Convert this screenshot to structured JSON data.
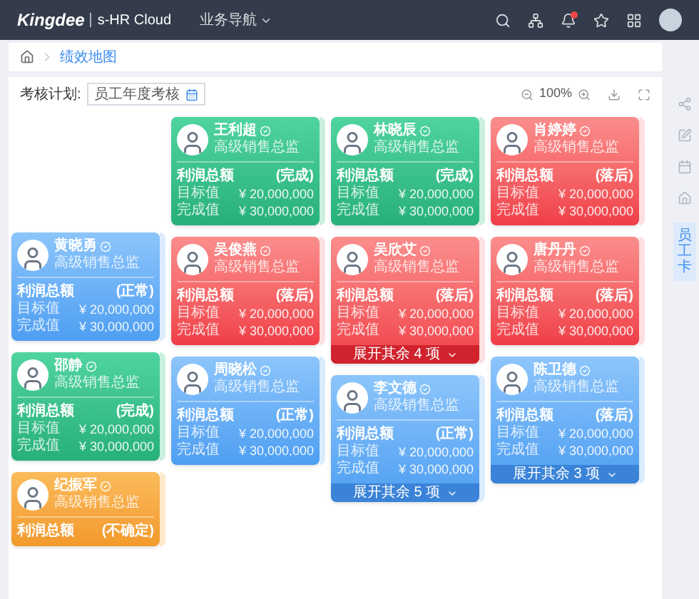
{
  "header": {
    "logo": "Kingdee",
    "product": "s-HR Cloud",
    "nav": "业务导航"
  },
  "breadcrumb": {
    "current": "绩效地图"
  },
  "toolbar": {
    "label": "考核计划:",
    "plan": "员工年度考核",
    "zoom": "100%"
  },
  "side_tab": "员工卡",
  "columns": [
    {
      "cards": [
        {
          "name": "黄晓勇",
          "title": "高级销售总监",
          "metric": "利润总额",
          "status": "(正常)",
          "kind": "normal",
          "rows": [
            {
              "label": "目标值",
              "value": "¥ 20,000,000"
            },
            {
              "label": "完成值",
              "value": "¥ 30,000,000"
            }
          ]
        },
        {
          "name": "邵静",
          "title": "高级销售总监",
          "metric": "利润总额",
          "status": "(完成)",
          "kind": "done",
          "rows": [
            {
              "label": "目标值",
              "value": "¥ 20,000,000"
            },
            {
              "label": "完成值",
              "value": "¥ 30,000,000"
            }
          ]
        },
        {
          "name": "纪振军",
          "title": "高级销售总监",
          "metric": "利润总额",
          "status": "(不确定)",
          "kind": "uncertain"
        }
      ]
    },
    {
      "cards": [
        {
          "name": "王利超",
          "title": "高级销售总监",
          "metric": "利润总额",
          "status": "(完成)",
          "kind": "done",
          "rows": [
            {
              "label": "目标值",
              "value": "¥ 20,000,000"
            },
            {
              "label": "完成值",
              "value": "¥ 30,000,000"
            }
          ]
        },
        {
          "name": "吴俊燕",
          "title": "高级销售总监",
          "metric": "利润总额",
          "status": "(落后)",
          "kind": "behind",
          "rows": [
            {
              "label": "目标值",
              "value": "¥ 20,000,000"
            },
            {
              "label": "完成值",
              "value": "¥ 30,000,000"
            }
          ]
        },
        {
          "name": "周晓松",
          "title": "高级销售总监",
          "metric": "利润总额",
          "status": "(正常)",
          "kind": "normal",
          "rows": [
            {
              "label": "目标值",
              "value": "¥ 20,000,000"
            },
            {
              "label": "完成值",
              "value": "¥ 30,000,000"
            }
          ]
        }
      ]
    },
    {
      "cards": [
        {
          "name": "林晓辰",
          "title": "高级销售总监",
          "metric": "利润总额",
          "status": "(完成)",
          "kind": "done",
          "rows": [
            {
              "label": "目标值",
              "value": "¥ 20,000,000"
            },
            {
              "label": "完成值",
              "value": "¥ 30,000,000"
            }
          ]
        },
        {
          "name": "吴欣艾",
          "title": "高级销售总监",
          "metric": "利润总额",
          "status": "(落后)",
          "kind": "behind",
          "rows": [
            {
              "label": "目标值",
              "value": "¥ 20,000,000"
            },
            {
              "label": "完成值",
              "value": "¥ 30,000,000"
            }
          ],
          "expand": "展开其余 4 项"
        },
        {
          "name": "李文德",
          "title": "高级销售总监",
          "metric": "利润总额",
          "status": "(正常)",
          "kind": "normal",
          "rows": [
            {
              "label": "目标值",
              "value": "¥ 20,000,000"
            },
            {
              "label": "完成值",
              "value": "¥ 30,000,000"
            }
          ],
          "expand": "展开其余 5 项"
        }
      ]
    },
    {
      "cards": [
        {
          "name": "肖婷婷",
          "title": "高级销售总监",
          "metric": "利润总额",
          "status": "(落后)",
          "kind": "behind",
          "rows": [
            {
              "label": "目标值",
              "value": "¥ 20,000,000"
            },
            {
              "label": "完成值",
              "value": "¥ 30,000,000"
            }
          ]
        },
        {
          "name": "唐丹丹",
          "title": "高级销售总监",
          "metric": "利润总额",
          "status": "(落后)",
          "kind": "behind",
          "rows": [
            {
              "label": "目标值",
              "value": "¥ 20,000,000"
            },
            {
              "label": "完成值",
              "value": "¥ 30,000,000"
            }
          ]
        },
        {
          "name": "陈卫德",
          "title": "高级销售总监",
          "metric": "利润总额",
          "status": "(落后)",
          "kind": "normal",
          "rows": [
            {
              "label": "目标值",
              "value": "¥ 20,000,000"
            },
            {
              "label": "完成值",
              "value": "¥ 30,000,000"
            }
          ],
          "expand": "展开其余 3 项"
        }
      ]
    }
  ]
}
